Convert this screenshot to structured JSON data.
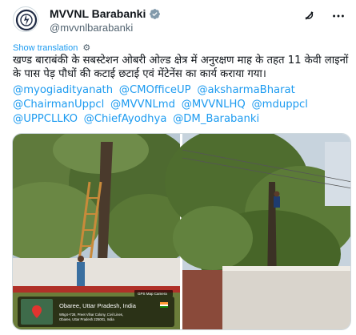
{
  "account": {
    "display_name": "MVVNL Barabanki",
    "handle": "@mvvnlbarabanki"
  },
  "translate": {
    "label": "Show translation"
  },
  "post": {
    "text": "खण्ड बाराबंकी के सबस्टेशन ओबरी ओल्ड क्षेत्र में अनुरक्षण माह के तहत 11 केवी लाइनों के पास पेड़ पौधों की कटाई छटाई एवं मेंटेनेंस का कार्य कराया गया।",
    "mentions": [
      "@myogiadityanath",
      "@CMOfficeUP",
      "@aksharmaBharat",
      "@ChairmanUppcl",
      "@MVVNLmd",
      "@MVVNLHQ",
      "@mduppcl",
      "@UPPCLLKO",
      "@ChiefAyodhya",
      "@DM_Barabanki"
    ]
  },
  "media": {
    "photo_left": {
      "watermark": "GPS Map Camera",
      "location_title": "Obaree, Uttar Pradesh, India",
      "location_address": "W5g4+728, Preet Vihar Colony, Civil Lines,",
      "location_address_2": "Obaree, Uttar Pradesh 225001, India"
    }
  },
  "icons": {
    "grok": "grok-icon",
    "more": "more-icon",
    "verified": "verified-badge-icon",
    "translate_settings": "gear-icon"
  },
  "colors": {
    "link": "#1d9bf0",
    "verified": "#829aab",
    "text": "#0f1419",
    "secondary": "#536471"
  }
}
